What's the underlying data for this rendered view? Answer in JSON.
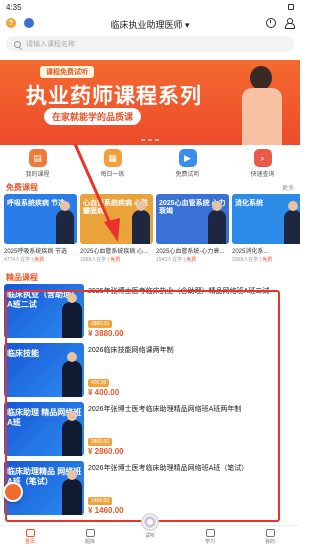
{
  "status_bar": {
    "time": "4:35"
  },
  "header": {
    "title": "临床执业助理医师"
  },
  "search": {
    "placeholder": "请输入课程名称"
  },
  "banner": {
    "tag": "课程免费试听",
    "title": "执业药师课程系列",
    "subtitle": "在家就能学的品质课"
  },
  "quick_nav": [
    {
      "label": "我的课程",
      "color": "#f07a3a"
    },
    {
      "label": "每日一练",
      "color": "#f3a03c"
    },
    {
      "label": "免费试听",
      "color": "#3b8ef0"
    },
    {
      "label": "快速查询",
      "color": "#e85a4a"
    }
  ],
  "free_section": {
    "title": "免费课程",
    "more": "更多",
    "cards": [
      {
        "thumb": "呼吸系统疾病 节选",
        "name": "2025呼吸系统疾病 节选",
        "meta_count": "4774人在学",
        "meta_tag": "免费",
        "bg": "#2a7de8"
      },
      {
        "thumb": "心血管系统疾病 心脏瓣膜病",
        "name": "2025心血管系统疾病 心...",
        "meta_count": "1688人在学",
        "meta_tag": "免费",
        "bg": "#e9a33a"
      },
      {
        "thumb": "2025心血管系统 心力衰竭",
        "name": "2025心血管系统-心力衰...",
        "meta_count": "1543人在学",
        "meta_tag": "免费",
        "bg": "#3a71d6"
      },
      {
        "thumb": "消化系统",
        "name": "2025消化系...",
        "meta_count": "2058人在学",
        "meta_tag": "免费",
        "bg": "#2c8be6"
      }
    ]
  },
  "course_section": {
    "title": "精品课程",
    "items": [
      {
        "thumb": "临床执业（含助理）A班二试",
        "title": "2025年张博士医考临床执业（含助理）精品网络班A班二试",
        "badge": "3880.00",
        "price": "¥ 3880.00"
      },
      {
        "thumb": "临床技能",
        "title": "2026临床技能网络课两年制",
        "badge": "400.00",
        "price": "¥ 400.00"
      },
      {
        "thumb": "临床助理 精品网络班A班",
        "title": "2026年张博士医考临床助理精品网络班A班两年制",
        "badge": "2860.00",
        "price": "¥ 2860.00"
      },
      {
        "thumb": "临床助理精品 网络班A班（笔试）",
        "title": "2026年张博士医考临床助理精品网络班A班（笔试）",
        "badge": "1460.00",
        "price": "¥ 1460.00"
      }
    ]
  },
  "tab_bar": [
    {
      "label": "首页",
      "active": true
    },
    {
      "label": "题库",
      "active": false
    },
    {
      "label": "试听",
      "active": false
    },
    {
      "label": "学习",
      "active": false
    },
    {
      "label": "我的",
      "active": false
    }
  ],
  "annotation_color": "#e8322a"
}
